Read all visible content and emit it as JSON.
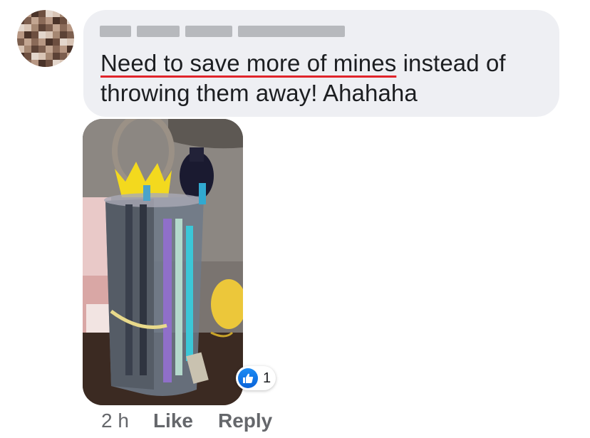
{
  "comment": {
    "author_name": "",
    "text_part1": "Need to save more of mines",
    "text_part2": " instead of throwing them away! Ahahaha",
    "spellcheck_color": "#e0242b"
  },
  "photo": {
    "description": "comment-photo"
  },
  "reactions": {
    "icon": "thumbs-up-icon",
    "count": "1",
    "accent": "#1877f2"
  },
  "actions": {
    "timestamp": "2 h",
    "like_label": "Like",
    "reply_label": "Reply"
  },
  "colors": {
    "bubble_bg": "#eeeff3",
    "text": "#1c1e21",
    "secondary_text": "#65676b"
  }
}
